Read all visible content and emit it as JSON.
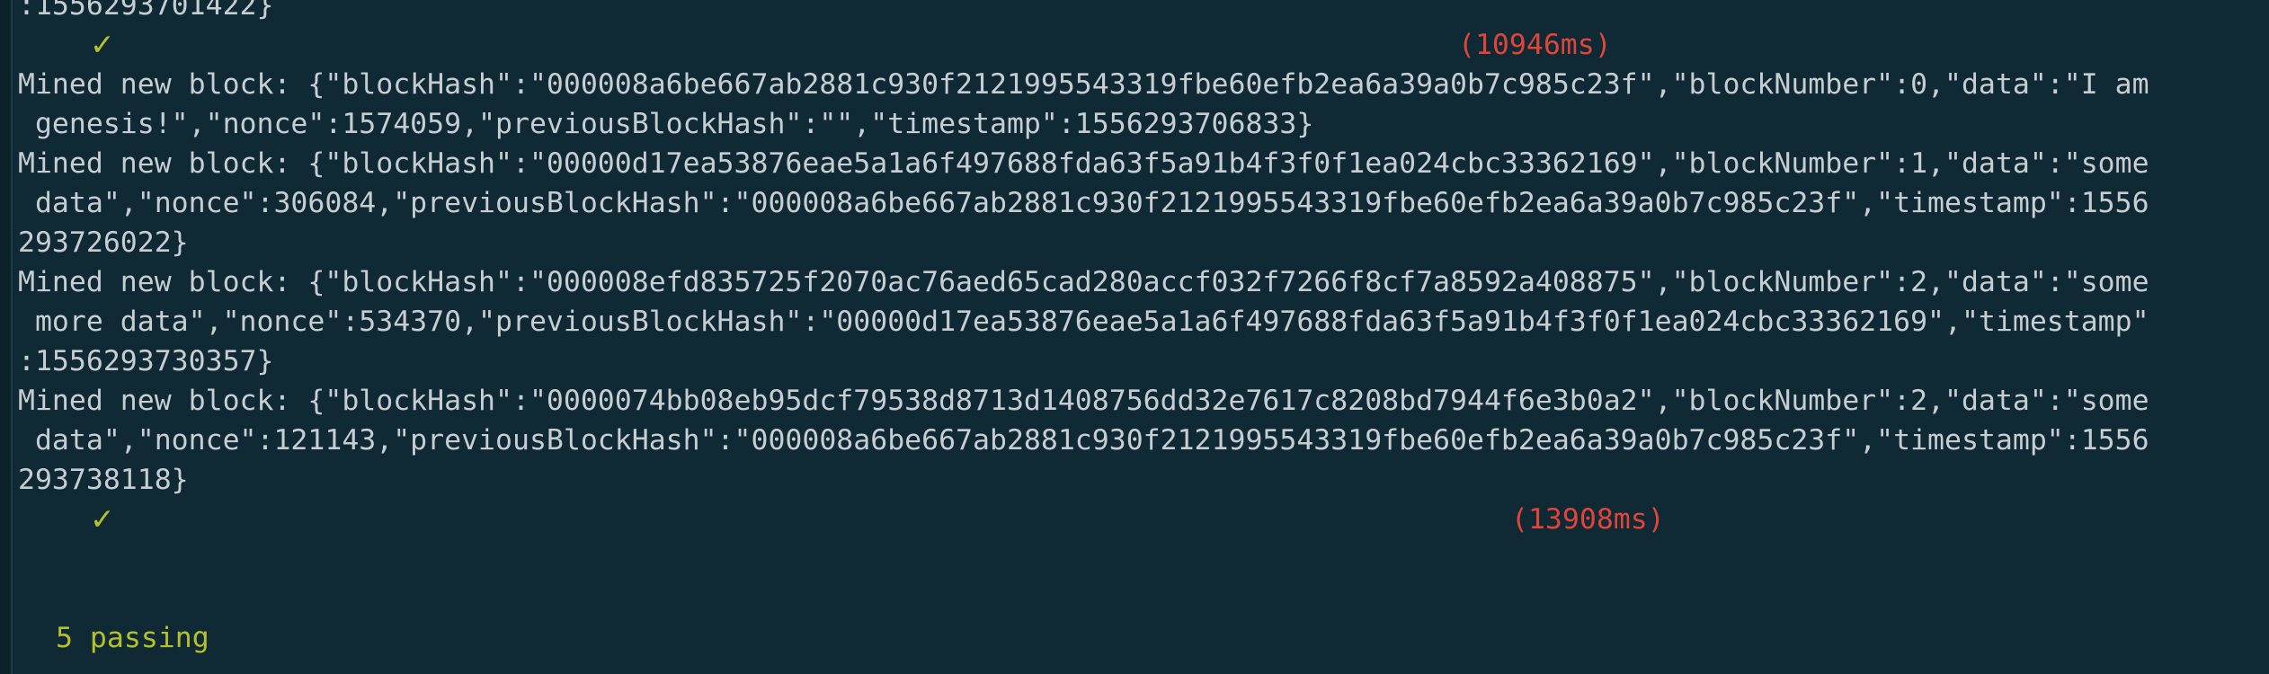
{
  "terminal": {
    "lines": [
      ":1556293701422}",
      "Mined new block: {\"blockHash\":\"000008a6be667ab2881c930f2121995543319fbe60efb2ea6a39a0b7c985c23f\",\"blockNumber\":0,\"data\":\"I am",
      " genesis!\",\"nonce\":1574059,\"previousBlockHash\":\"\",\"timestamp\":1556293706833}",
      "Mined new block: {\"blockHash\":\"00000d17ea53876eae5a1a6f497688fda63f5a91b4f3f0f1ea024cbc33362169\",\"blockNumber\":1,\"data\":\"some",
      " data\",\"nonce\":306084,\"previousBlockHash\":\"000008a6be667ab2881c930f2121995543319fbe60efb2ea6a39a0b7c985c23f\",\"timestamp\":1556",
      "293726022}",
      "Mined new block: {\"blockHash\":\"000008efd835725f2070ac76aed65cad280accf032f7266f8cf7a8592a408875\",\"blockNumber\":2,\"data\":\"some",
      " more data\",\"nonce\":534370,\"previousBlockHash\":\"00000d17ea53876eae5a1a6f497688fda63f5a91b4f3f0f1ea024cbc33362169\",\"timestamp\"",
      ":1556293730357}",
      "Mined new block: {\"blockHash\":\"0000074bb08eb95dcf79538d8713d1408756dd32e7617c8208bd7944f6e3b0a2\",\"blockNumber\":2,\"data\":\"some",
      " data\",\"nonce\":121143,\"previousBlockHash\":\"000008a6be667ab2881c930f2121995543319fbe60efb2ea6a39a0b7c985c23f\",\"timestamp\":1556",
      "293738118}"
    ],
    "checks": [
      {
        "mark": "✓",
        "duration": "(10946ms)"
      },
      {
        "mark": "✓",
        "duration": "(13908ms)"
      }
    ],
    "summary": "5 passing"
  },
  "colors": {
    "background": "#0f2a35",
    "text": "#c7cdd1",
    "check": "#b6c02b",
    "duration": "#e0453a",
    "passing": "#b6c02b"
  }
}
